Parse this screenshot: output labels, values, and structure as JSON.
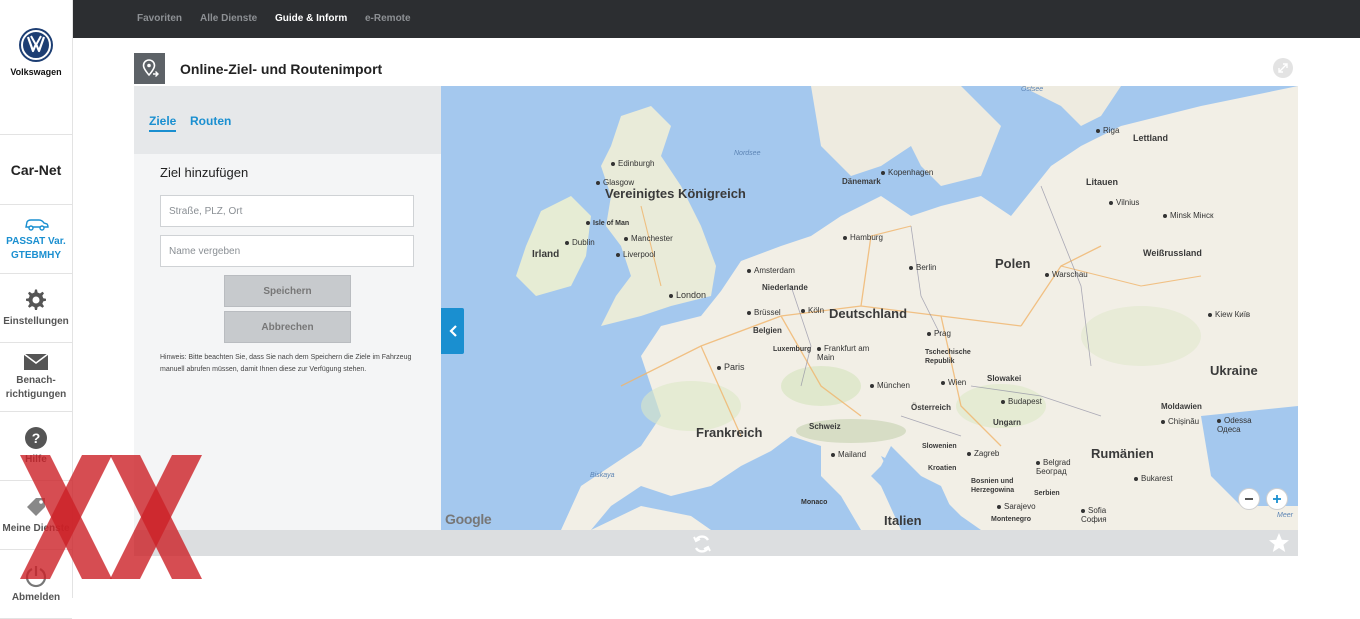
{
  "brand": {
    "name": "Volkswagen",
    "service": "Car-Net"
  },
  "sidebar": {
    "vehicle": {
      "line1": "PASSAT Var.",
      "line2": "GTEBMHY"
    },
    "settings": "Einstellungen",
    "notifications": {
      "line1": "Benach-",
      "line2": "richtigungen"
    },
    "help": "Hilfe",
    "my_services": "Meine Dienste",
    "logout": "Abmelden"
  },
  "topnav": {
    "tabs": [
      "Favoriten",
      "Alle Dienste",
      "Guide & Inform",
      "e-Remote"
    ],
    "active": "Guide & Inform"
  },
  "panel": {
    "title": "Online-Ziel- und Routenimport"
  },
  "form": {
    "tabs": [
      "Ziele",
      "Routen"
    ],
    "heading": "Ziel hinzufügen",
    "address_placeholder": "Straße, PLZ, Ort",
    "name_placeholder": "Name vergeben",
    "save_label": "Speichern",
    "cancel_label": "Abbrechen",
    "hint": "Hinweis: Bitte beachten Sie, dass Sie nach dem Speichern die Ziele im Fahrzeug manuell abrufen müssen, damit Ihnen diese zur Verfügung stehen."
  },
  "map": {
    "attribution": "Google",
    "countries": [
      "Vereinigtes Königreich",
      "Irland",
      "Deutschland",
      "Frankreich",
      "Polen",
      "Ukraine",
      "Rumänien",
      "Italien",
      "Litauen",
      "Lettland",
      "Weißrussland",
      "Dänemark",
      "Niederlande",
      "Belgien",
      "Luxemburg",
      "Schweiz",
      "Österreich",
      "Slowakei",
      "Ungarn",
      "Moldawien",
      "Slowenien",
      "Kroatien",
      "Serbien",
      "Tschechische Republik",
      "Bosnien und Herzegowina",
      "Montenegro"
    ],
    "cities": [
      "Edinburgh",
      "Glasgow",
      "Isle of Man",
      "Dublin",
      "Manchester",
      "Liverpool",
      "London",
      "Amsterdam",
      "Brüssel",
      "Köln",
      "Frankfurt am Main",
      "Paris",
      "Hamburg",
      "Kopenhagen",
      "Berlin",
      "Prag",
      "München",
      "Wien",
      "Budapest",
      "Warschau",
      "Minsk Мінск",
      "Vilnius",
      "Riga",
      "Kiew Київ",
      "Chișinău",
      "Odessa Одеса",
      "Bukarest",
      "Belgrad Београд",
      "Sarajevo",
      "Sofia София",
      "Zagreb",
      "Mailand",
      "Monaco"
    ],
    "seas": [
      "Nordsee",
      "Ostsee",
      "Biskaya"
    ],
    "sea_partial": "Meer"
  },
  "colors": {
    "accent": "#1a8fd0",
    "topbar": "#2c2e31",
    "water": "#a4c8ee",
    "land": "#f2efe6"
  }
}
